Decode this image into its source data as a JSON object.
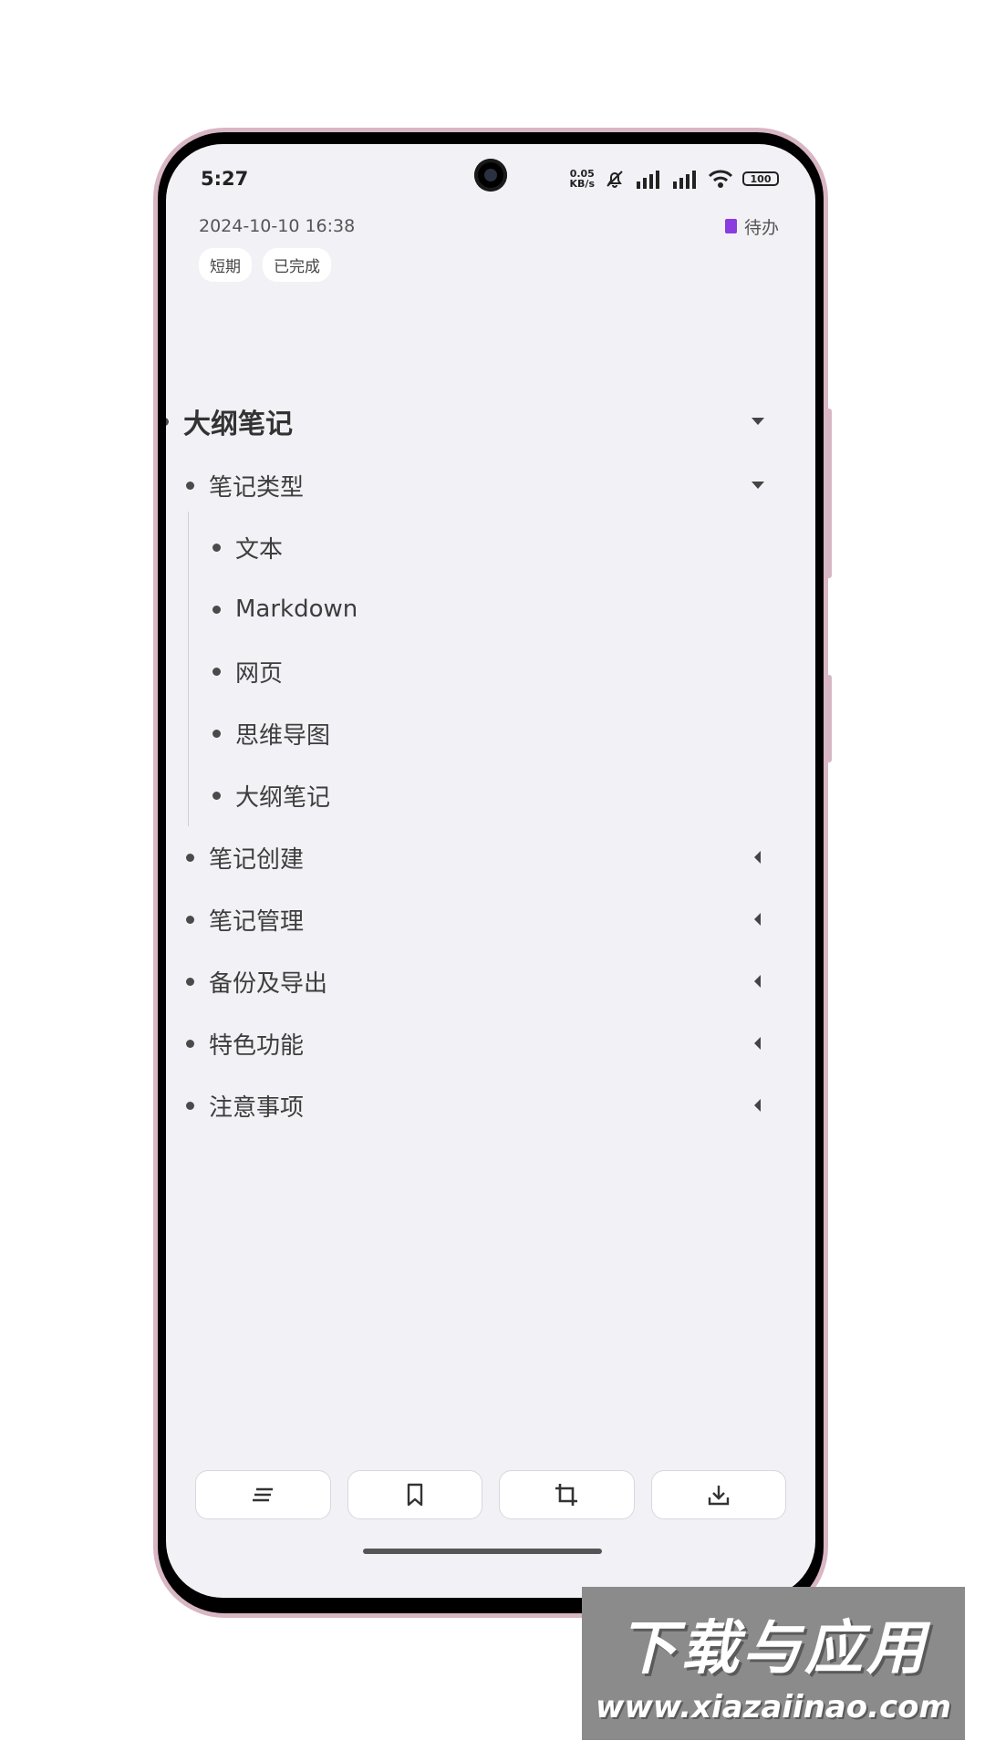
{
  "status_bar": {
    "time": "5:27",
    "net_speed_top": "0.05",
    "net_speed_bottom": "KB/s",
    "battery": "100"
  },
  "header": {
    "date": "2024-10-10 16:38",
    "todo_label": "待办",
    "todo_color": "#8b3ce0"
  },
  "tags": [
    "短期",
    "已完成"
  ],
  "outline": {
    "root": "大纲笔记",
    "items": [
      {
        "label": "笔记类型",
        "children": [
          "文本",
          "Markdown",
          "网页",
          "思维导图",
          "大纲笔记"
        ]
      },
      {
        "label": "笔记创建"
      },
      {
        "label": "笔记管理"
      },
      {
        "label": "备份及导出"
      },
      {
        "label": "特色功能"
      },
      {
        "label": "注意事项"
      }
    ]
  },
  "toolbar": {
    "icons": [
      "outline-text-icon",
      "bookmark-icon",
      "crop-icon",
      "download-icon"
    ]
  },
  "watermark": {
    "cn": "下载与应用",
    "url": "www.xiazaiinao.com"
  }
}
